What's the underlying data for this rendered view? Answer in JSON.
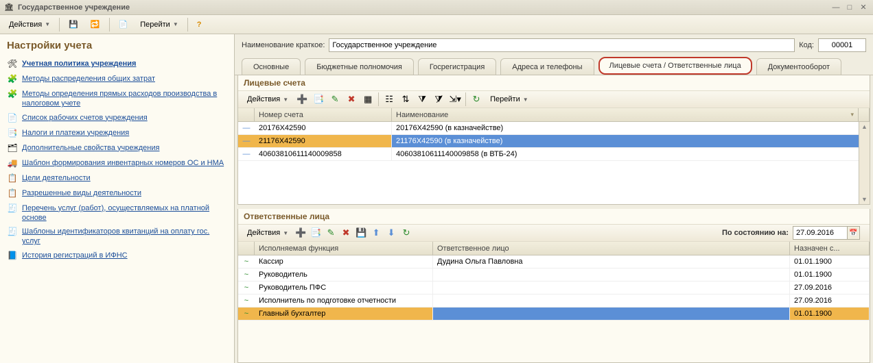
{
  "window": {
    "title": "Государственное учреждение"
  },
  "mainToolbar": {
    "actions": "Действия",
    "goto": "Перейти"
  },
  "sidebar": {
    "heading": "Настройки учета",
    "items": [
      {
        "label": "Учетная политика учреждения",
        "bold": true,
        "icon": "🛠"
      },
      {
        "label": "Методы распределения общих затрат",
        "icon": "🧩"
      },
      {
        "label": "Методы определения прямых расходов производства в налоговом учете",
        "icon": "🧩"
      },
      {
        "label": "Список рабочих счетов учреждения",
        "icon": "📄"
      },
      {
        "label": "Налоги и платежи учреждения",
        "icon": "📑"
      },
      {
        "label": "Дополнительные свойства учреждения",
        "icon": "🗂"
      },
      {
        "label": "Шаблон формирования инвентарных номеров ОС и НМА",
        "icon": "🚚"
      },
      {
        "label": "Цели деятельности",
        "icon": "📋"
      },
      {
        "label": "Разрешенные виды деятельности",
        "icon": "📋"
      },
      {
        "label": "Перечень услуг (работ), осуществляемых на платной основе",
        "icon": "🧾"
      },
      {
        "label": "Шаблоны идентификаторов квитанций на оплату гос. услуг",
        "icon": "🧾"
      },
      {
        "label": "История регистраций в ИФНС",
        "icon": "📘"
      }
    ]
  },
  "header": {
    "nameLabel": "Наименование краткое:",
    "name": "Государственное учреждение",
    "codeLabel": "Код:",
    "code": "00001"
  },
  "tabs": {
    "t1": "Основные",
    "t2": "Бюджетные полномочия",
    "t3": "Госрегистрация",
    "t4": "Адреса и телефоны",
    "t5": "Лицевые счета / Ответственные лица",
    "t6": "Документооборот"
  },
  "accounts": {
    "title": "Лицевые счета",
    "actions": "Действия",
    "goto": "Перейти",
    "col1": "Номер счета",
    "col2": "Наименование",
    "rows": [
      {
        "num": "20176X42590",
        "name": "20176X42590 (в казначействе)"
      },
      {
        "num": "21176X42590",
        "name": "21176X42590 (в казначействе)"
      },
      {
        "num": "40603810611140009858",
        "name": "40603810611140009858 (в ВТБ-24)"
      }
    ]
  },
  "persons": {
    "title": "Ответственные лица",
    "actions": "Действия",
    "asOfLabel": "По состоянию на:",
    "asOf": "27.09.2016",
    "col1": "Исполняемая функция",
    "col2": "Ответственное лицо",
    "col3": "Назначен с...",
    "rows": [
      {
        "fn": "Кассир",
        "person": "Дудина Ольга Павловна",
        "date": "01.01.1900"
      },
      {
        "fn": "Руководитель",
        "person": "",
        "date": "01.01.1900"
      },
      {
        "fn": "Руководитель ПФС",
        "person": "",
        "date": "27.09.2016"
      },
      {
        "fn": "Исполнитель по подготовке отчетности",
        "person": "",
        "date": "27.09.2016"
      },
      {
        "fn": "Главный бухгалтер",
        "person": "",
        "date": "01.01.1900"
      }
    ]
  }
}
